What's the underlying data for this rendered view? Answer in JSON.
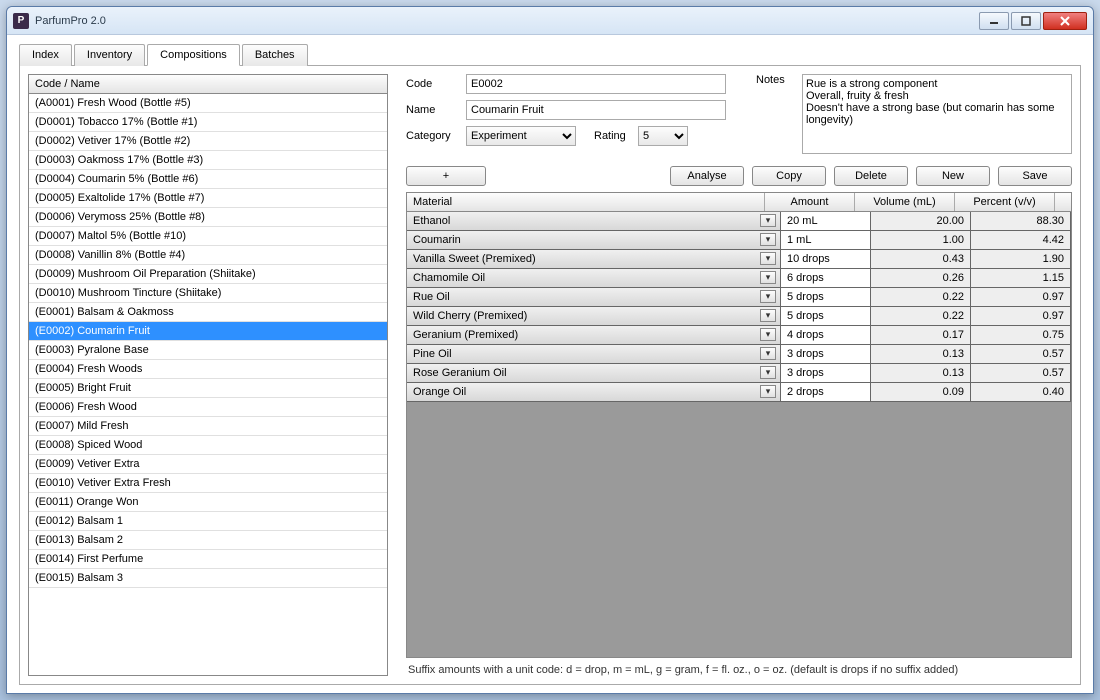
{
  "title": "ParfumPro 2.0",
  "tabs": [
    "Index",
    "Inventory",
    "Compositions",
    "Batches"
  ],
  "active_tab": 2,
  "list_header": "Code / Name",
  "list_items": [
    "(A0001) Fresh Wood (Bottle #5)",
    "(D0001) Tobacco 17% (Bottle #1)",
    "(D0002) Vetiver 17% (Bottle #2)",
    "(D0003) Oakmoss 17% (Bottle #3)",
    "(D0004) Coumarin 5% (Bottle #6)",
    "(D0005) Exaltolide 17% (Bottle #7)",
    "(D0006) Verymoss 25% (Bottle #8)",
    "(D0007) Maltol 5% (Bottle #10)",
    "(D0008) Vanillin 8% (Bottle #4)",
    "(D0009) Mushroom Oil Preparation (Shiitake)",
    "(D0010) Mushroom Tincture (Shiitake)",
    "(E0001) Balsam & Oakmoss",
    "(E0002) Coumarin Fruit",
    "(E0003) Pyralone Base",
    "(E0004) Fresh Woods",
    "(E0005) Bright Fruit",
    "(E0006) Fresh Wood",
    "(E0007) Mild Fresh",
    "(E0008) Spiced Wood",
    "(E0009) Vetiver Extra",
    "(E0010) Vetiver Extra Fresh",
    "(E0011) Orange Won",
    "(E0012) Balsam 1",
    "(E0013) Balsam 2",
    "(E0014) First Perfume",
    "(E0015) Balsam 3"
  ],
  "selected_index": 12,
  "form": {
    "code_label": "Code",
    "code_value": "E0002",
    "name_label": "Name",
    "name_value": "Coumarin Fruit",
    "category_label": "Category",
    "category_value": "Experiment",
    "rating_label": "Rating",
    "rating_value": "5",
    "notes_label": "Notes",
    "notes_value": "Rue is a strong component\nOverall, fruity & fresh\nDoesn't have a strong base (but comarin has some longevity)"
  },
  "buttons": {
    "add": "+",
    "analyse": "Analyse",
    "copy": "Copy",
    "delete": "Delete",
    "new": "New",
    "save": "Save"
  },
  "grid": {
    "headers": {
      "material": "Material",
      "amount": "Amount",
      "volume": "Volume (mL)",
      "percent": "Percent (v/v)"
    },
    "rows": [
      {
        "material": "Ethanol",
        "amount": "20 mL",
        "volume": "20.00",
        "percent": "88.30"
      },
      {
        "material": "Coumarin",
        "amount": "1 mL",
        "volume": "1.00",
        "percent": "4.42"
      },
      {
        "material": "Vanilla Sweet (Premixed)",
        "amount": "10 drops",
        "volume": "0.43",
        "percent": "1.90"
      },
      {
        "material": "Chamomile Oil",
        "amount": "6 drops",
        "volume": "0.26",
        "percent": "1.15"
      },
      {
        "material": "Rue Oil",
        "amount": "5 drops",
        "volume": "0.22",
        "percent": "0.97"
      },
      {
        "material": "Wild Cherry (Premixed)",
        "amount": "5 drops",
        "volume": "0.22",
        "percent": "0.97"
      },
      {
        "material": "Geranium (Premixed)",
        "amount": "4 drops",
        "volume": "0.17",
        "percent": "0.75"
      },
      {
        "material": "Pine Oil",
        "amount": "3 drops",
        "volume": "0.13",
        "percent": "0.57"
      },
      {
        "material": "Rose Geranium Oil",
        "amount": "3 drops",
        "volume": "0.13",
        "percent": "0.57"
      },
      {
        "material": "Orange Oil",
        "amount": "2 drops",
        "volume": "0.09",
        "percent": "0.40"
      }
    ]
  },
  "hint": "Suffix amounts with a unit code: d = drop, m = mL, g = gram, f = fl. oz., o = oz. (default is drops if no suffix added)"
}
